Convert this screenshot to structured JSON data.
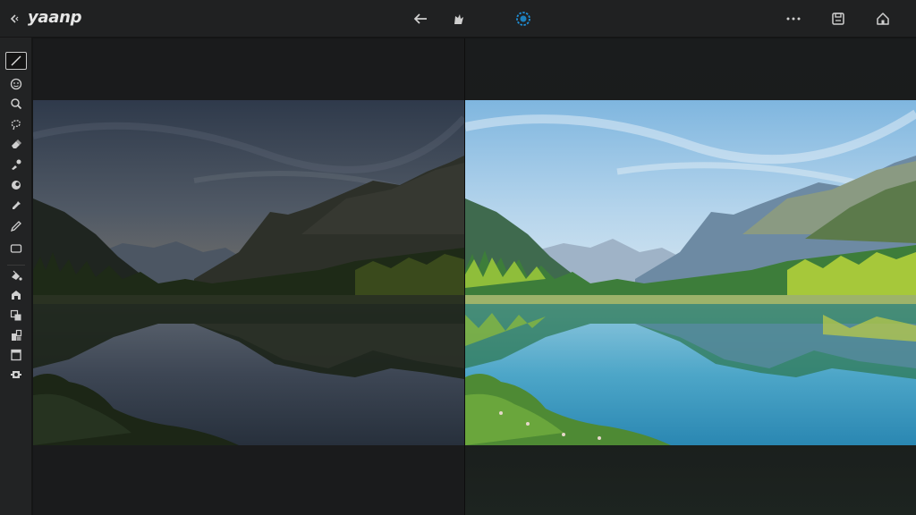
{
  "app": {
    "title": "yaanp"
  },
  "icons": {
    "topbar": [
      "collapse-icon",
      "back-arrow-icon",
      "brush-icon",
      "ai-enhance-icon",
      "more-icon",
      "save-icon",
      "home-icon"
    ],
    "tools": [
      "crop-icon",
      "face-retouch-icon",
      "zoom-icon",
      "lasso-icon",
      "eraser-icon",
      "healing-icon",
      "blur-icon",
      "dropper-icon",
      "pen-icon",
      "frame-icon",
      "fill-icon",
      "stamp-icon",
      "transform-icon",
      "layers-icon",
      "export-icon",
      "settings-icon"
    ]
  },
  "colors": {
    "accent": "#1f8fd6",
    "topbar_bg": "#202122",
    "rail_bg": "#222324",
    "workspace_bg": "#1b1c1d"
  }
}
